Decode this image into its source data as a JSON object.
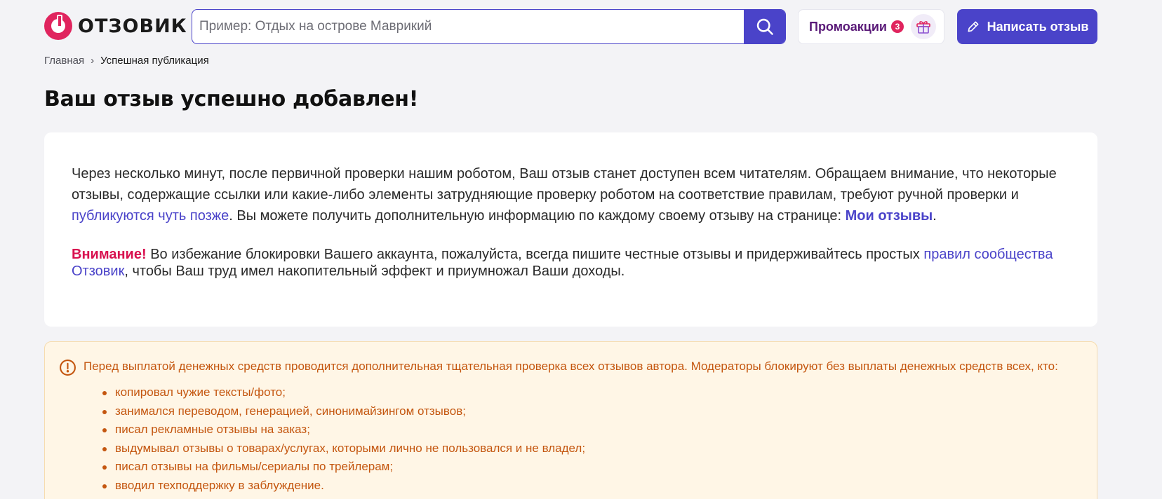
{
  "header": {
    "logo_text": "ОТЗОВИК",
    "search_placeholder": "Пример: Отдых на острове Маврикий",
    "promo_label": "Промоакции",
    "promo_count": "3",
    "write_review_label": "Написать отзыв"
  },
  "breadcrumb": {
    "home": "Главная",
    "separator": "›",
    "current": "Успешная публикация"
  },
  "page_title": "Ваш отзыв успешно добавлен!",
  "card": {
    "p1_text1": "Через несколько минут, после первичной проверки нашим роботом, Ваш отзыв станет доступен всем читателям. Обращаем внимание, что некоторые отзывы, содержащие ссылки или какие-либо элементы затрудняющие проверку роботом на соответствие правилам, требуют ручной проверки и ",
    "p1_link": "публикуются чуть позже",
    "p1_text2": ". Вы можете получить дополнительную информацию по каждому своему отзыву на странице: ",
    "my_reviews_link": "Мои отзывы",
    "p1_end": ".",
    "warning_label": "Внимание!",
    "p2_text1": " Во избежание блокировки Вашего аккаунта, пожалуйста, всегда пишите честные отзывы и придерживайтесь простых ",
    "rules_link": "правил сообщества Отзовик",
    "p2_text2": ", чтобы Ваш труд имел накопительный эффект и приумножал Ваши доходы."
  },
  "notice": {
    "icon": "exclamation-circle-icon",
    "text": "Перед выплатой денежных средств проводится дополнительная тщательная проверка всех отзывов автора. Модераторы блокируют без выплаты денежных средств всех, кто:",
    "items": [
      "копировал чужие тексты/фото;",
      "занимался переводом, генерацией, синонимайзингом отзывов;",
      "писал рекламные отзывы на заказ;",
      "выдумывал отзывы о товарах/услугах, которыми лично не пользовался и не владел;",
      "писал отзывы на фильмы/сериалы по трейлерам;",
      "вводил техподдержку в заблуждение."
    ]
  },
  "colors": {
    "brand_accent": "#4a43c9",
    "logo_red": "#e0245e",
    "warning_red": "#d8114f",
    "notice_text": "#c4560f",
    "notice_bg": "#fff6e6"
  }
}
